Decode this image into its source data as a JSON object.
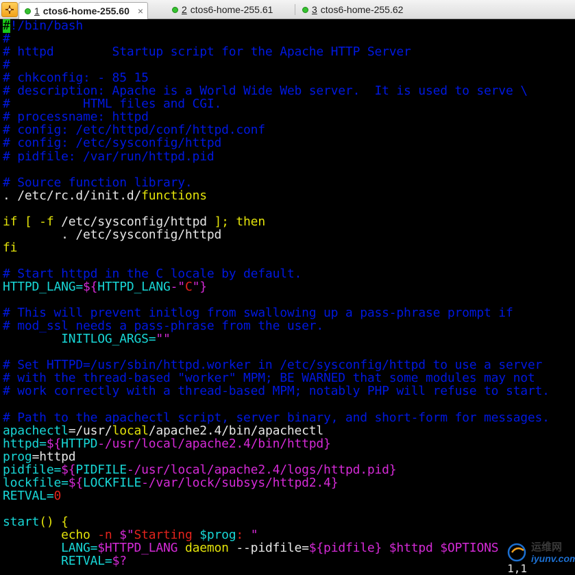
{
  "tabs": [
    {
      "num": "1",
      "label": "ctos6-home-255.60",
      "active": true,
      "close": "×"
    },
    {
      "num": "2",
      "label": "ctos6-home-255.61",
      "active": false
    },
    {
      "num": "3",
      "label": "ctos6-home-255.62",
      "active": false
    }
  ],
  "colors": {
    "background": "#000000",
    "comment": "#0018e0",
    "keyword": "#e2e20a",
    "variable": "#18d6d6",
    "string": "#d42ad6",
    "number": "#e2231c",
    "cursor": "#19c819"
  },
  "lines": [
    [
      {
        "t": "#",
        "c": "cursor"
      },
      {
        "t": "!/bin/bash",
        "c": "c"
      }
    ],
    [
      {
        "t": "#",
        "c": "c"
      }
    ],
    [
      {
        "t": "# httpd        Startup script for the Apache HTTP Server",
        "c": "c"
      }
    ],
    [
      {
        "t": "#",
        "c": "c"
      }
    ],
    [
      {
        "t": "# chkconfig: - 85 15",
        "c": "c"
      }
    ],
    [
      {
        "t": "# description: Apache is a World Wide Web server.  It is used to serve \\",
        "c": "c"
      }
    ],
    [
      {
        "t": "#          HTML files and CGI.",
        "c": "c"
      }
    ],
    [
      {
        "t": "# processname: httpd",
        "c": "c"
      }
    ],
    [
      {
        "t": "# config: /etc/httpd/conf/httpd.conf",
        "c": "c"
      }
    ],
    [
      {
        "t": "# config: /etc/sysconfig/httpd",
        "c": "c"
      }
    ],
    [
      {
        "t": "# pidfile: /var/run/httpd.pid",
        "c": "c"
      }
    ],
    [],
    [
      {
        "t": "# Source function library.",
        "c": "c"
      }
    ],
    [
      {
        "t": ". /etc/rc.d/init.d/",
        "c": "w"
      },
      {
        "t": "functions",
        "c": "y"
      }
    ],
    [],
    [
      {
        "t": "if [ -f ",
        "c": "y"
      },
      {
        "t": "/etc/sysconfig/httpd ",
        "c": "w"
      },
      {
        "t": "]; then",
        "c": "y"
      }
    ],
    [
      {
        "t": "        . /etc/sysconfig/httpd",
        "c": "w"
      }
    ],
    [
      {
        "t": "fi",
        "c": "y"
      }
    ],
    [],
    [
      {
        "t": "# Start httpd in the C locale by default.",
        "c": "c"
      }
    ],
    [
      {
        "t": "HTTPD_LANG=",
        "c": "n"
      },
      {
        "t": "${",
        "c": "m"
      },
      {
        "t": "HTTPD_LANG",
        "c": "n"
      },
      {
        "t": "-\"",
        "c": "m"
      },
      {
        "t": "C",
        "c": "r"
      },
      {
        "t": "\"}",
        "c": "m"
      }
    ],
    [],
    [
      {
        "t": "# This will prevent initlog from swallowing up a pass-phrase prompt if",
        "c": "c"
      }
    ],
    [
      {
        "t": "# mod_ssl needs a pass-phrase from the user.",
        "c": "c"
      }
    ],
    [
      {
        "t": "        INITLOG_ARGS=",
        "c": "n"
      },
      {
        "t": "\"\"",
        "c": "m"
      }
    ],
    [],
    [
      {
        "t": "# Set HTTPD=/usr/sbin/httpd.worker in /etc/sysconfig/httpd to use a server",
        "c": "c"
      }
    ],
    [
      {
        "t": "# with the thread-based \"worker\" MPM; BE WARNED that some modules may not",
        "c": "c"
      }
    ],
    [
      {
        "t": "# work correctly with a thread-based MPM; notably PHP will refuse to start.",
        "c": "c"
      }
    ],
    [],
    [
      {
        "t": "# Path to the apachectl script, server binary, and short-form for messages.",
        "c": "c"
      }
    ],
    [
      {
        "t": "apachectl",
        "c": "n"
      },
      {
        "t": "=/usr/",
        "c": "w"
      },
      {
        "t": "local",
        "c": "y"
      },
      {
        "t": "/apache2.4/bin/apachectl",
        "c": "w"
      }
    ],
    [
      {
        "t": "httpd=",
        "c": "n"
      },
      {
        "t": "${",
        "c": "m"
      },
      {
        "t": "HTTPD",
        "c": "n"
      },
      {
        "t": "-/usr/local/apache2.4/bin/httpd",
        "c": "m"
      },
      {
        "t": "}",
        "c": "m"
      }
    ],
    [
      {
        "t": "prog",
        "c": "n"
      },
      {
        "t": "=httpd",
        "c": "w"
      }
    ],
    [
      {
        "t": "pidfile=",
        "c": "n"
      },
      {
        "t": "${",
        "c": "m"
      },
      {
        "t": "PIDFILE",
        "c": "n"
      },
      {
        "t": "-/usr/local/apache2.4/logs/httpd.pid",
        "c": "m"
      },
      {
        "t": "}",
        "c": "m"
      }
    ],
    [
      {
        "t": "lockfile=",
        "c": "n"
      },
      {
        "t": "${",
        "c": "m"
      },
      {
        "t": "LOCKFILE",
        "c": "n"
      },
      {
        "t": "-/var/lock/subsys/httpd2.4",
        "c": "m"
      },
      {
        "t": "}",
        "c": "m"
      }
    ],
    [
      {
        "t": "RETVAL=",
        "c": "n"
      },
      {
        "t": "0",
        "c": "r"
      }
    ],
    [],
    [
      {
        "t": "start",
        "c": "n"
      },
      {
        "t": "() {",
        "c": "y"
      }
    ],
    [
      {
        "t": "        echo ",
        "c": "y"
      },
      {
        "t": "-n ",
        "c": "r"
      },
      {
        "t": "$\"",
        "c": "m"
      },
      {
        "t": "Starting ",
        "c": "r"
      },
      {
        "t": "$prog",
        "c": "n"
      },
      {
        "t": ": ",
        "c": "r"
      },
      {
        "t": "\"",
        "c": "m"
      }
    ],
    [
      {
        "t": "        LANG=",
        "c": "n"
      },
      {
        "t": "$HTTPD_LANG ",
        "c": "m"
      },
      {
        "t": "daemon ",
        "c": "y"
      },
      {
        "t": "--pidfile=",
        "c": "w"
      },
      {
        "t": "${pidfile} ",
        "c": "m"
      },
      {
        "t": "$httpd $OPTIONS",
        "c": "m"
      }
    ],
    [
      {
        "t": "        RETVAL=",
        "c": "n"
      },
      {
        "t": "$?",
        "c": "m"
      }
    ]
  ],
  "watermark": {
    "cn": "运维网",
    "en": "iyunv.com"
  },
  "cursor_position": "1,1"
}
